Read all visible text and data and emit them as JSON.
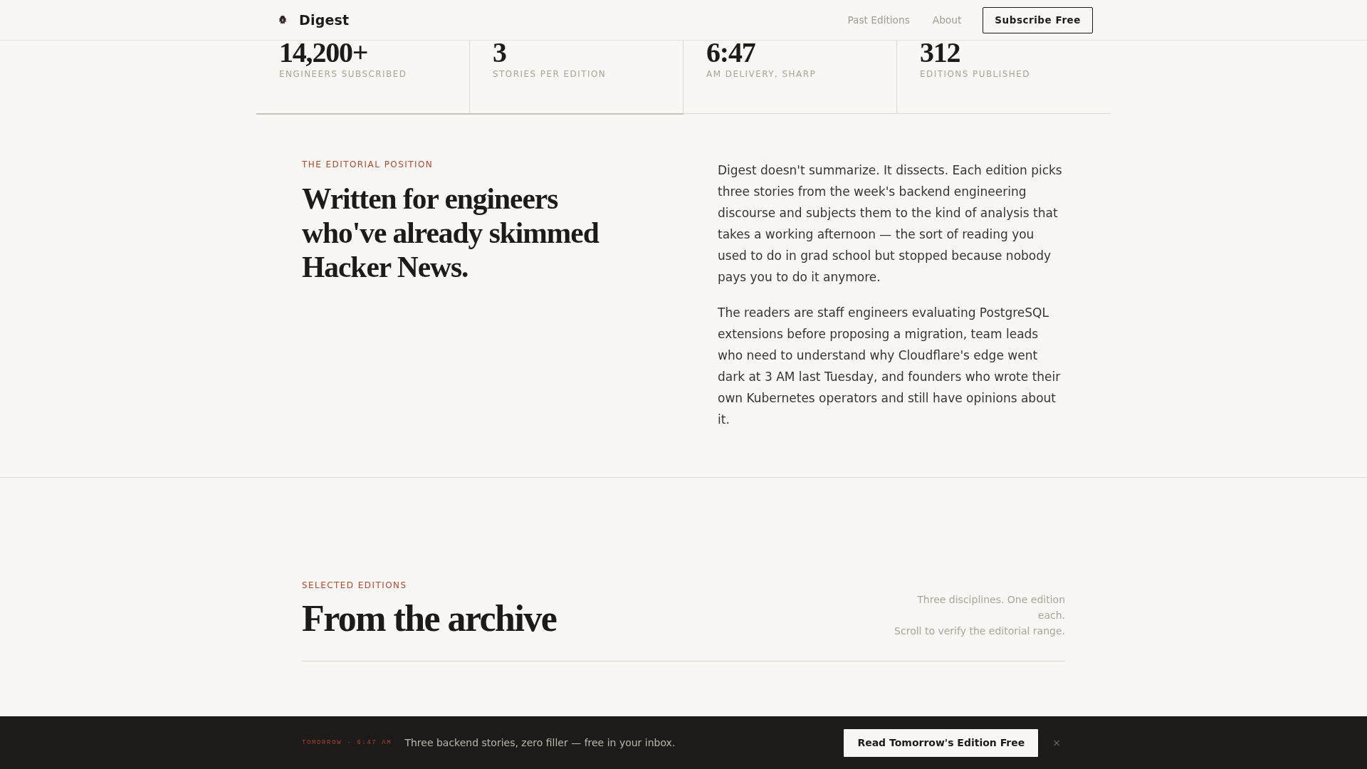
{
  "header": {
    "brand": "Digest",
    "nav": [
      {
        "label": "Past Editions"
      },
      {
        "label": "About"
      }
    ],
    "cta": "Subscribe Free"
  },
  "stats": [
    {
      "value": "14,200+",
      "label": "ENGINEERS SUBSCRIBED"
    },
    {
      "value": "3",
      "label": "STORIES PER EDITION"
    },
    {
      "value": "6:47",
      "label": "AM DELIVERY, SHARP"
    },
    {
      "value": "312",
      "label": "EDITIONS PUBLISHED"
    }
  ],
  "progress": {
    "level": 0.5
  },
  "editorial": {
    "eyebrow": "THE EDITORIAL POSITION",
    "heading": "Written for engineers who've already skimmed Hacker News.",
    "paragraphs": [
      "Digest doesn't summarize. It dissects. Each edition picks three stories from the week's backend engineering discourse and subjects them to the kind of analysis that takes a working afternoon — the sort of reading you used to do in grad school but stopped because nobody pays you to do it anymore.",
      "The readers are staff engineers evaluating PostgreSQL extensions before proposing a migration, team leads who need to understand why Cloudflare's edge went dark at 3 AM last Tuesday, and founders who wrote their own Kubernetes operators and still have opinions about it."
    ]
  },
  "archive": {
    "eyebrow": "SELECTED EDITIONS",
    "heading": "From the archive",
    "note": [
      "Three disciplines. One edition each.",
      "Scroll to verify the editorial range."
    ]
  },
  "banner": {
    "tag": "TOMORROW · 6:47 AM",
    "text": "Three backend stories, zero filler — free in your inbox.",
    "button": "Read Tomorrow's Edition Free",
    "close": "×"
  }
}
